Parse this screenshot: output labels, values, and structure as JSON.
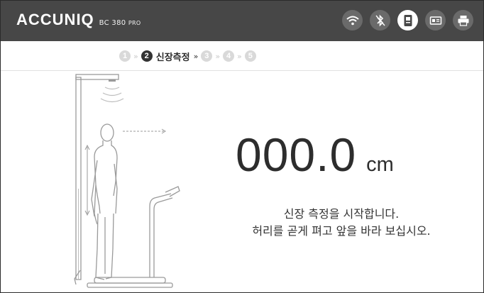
{
  "header": {
    "brand": "ACCUNIQ",
    "model": "BC 380",
    "model_suffix": "PRO",
    "icons": [
      "wifi-icon",
      "bluetooth-icon",
      "id-card-icon",
      "card-reader-icon",
      "printer-icon"
    ],
    "background": "#474747"
  },
  "steps": {
    "items": [
      {
        "num": "1"
      },
      {
        "num": "2",
        "label": "신장측정"
      },
      {
        "num": "3"
      },
      {
        "num": "4"
      },
      {
        "num": "5"
      }
    ],
    "separator": "»"
  },
  "measurement": {
    "value": "000.0",
    "unit": "cm"
  },
  "message": {
    "line1": "신장 측정을 시작합니다.",
    "line2": "허리를 곧게 펴고 앞을 바라 보십시오."
  }
}
